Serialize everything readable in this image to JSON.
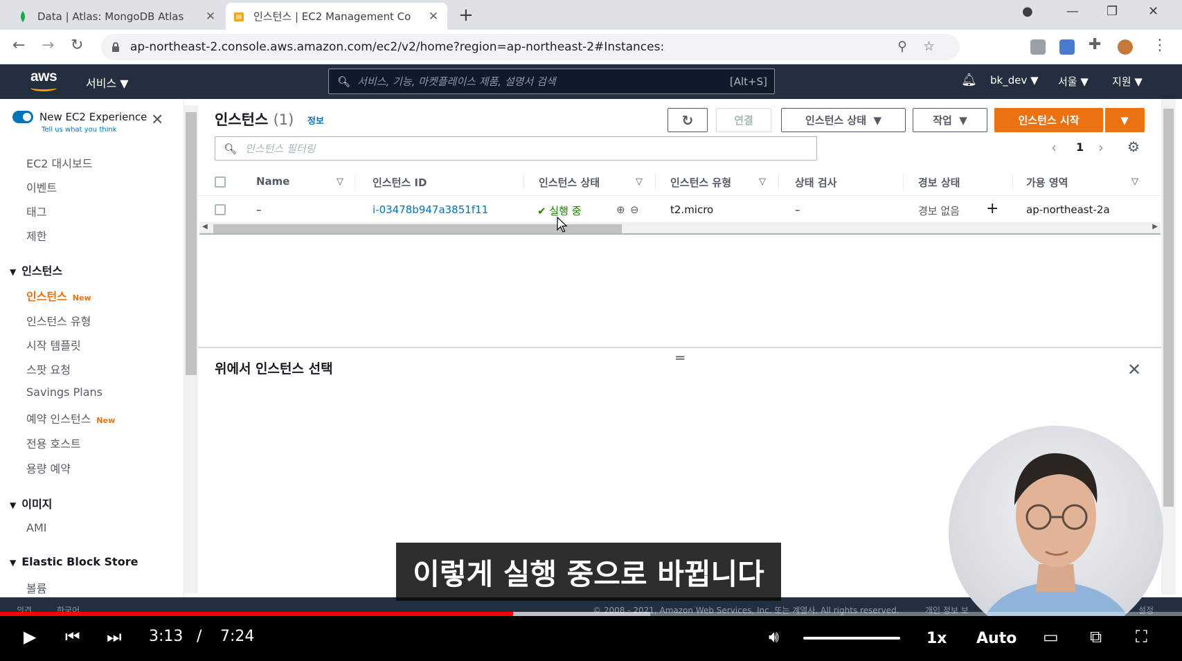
{
  "browser": {
    "tabs": [
      {
        "title": "Data | Atlas: MongoDB Atlas",
        "active": false
      },
      {
        "title": "인스턴스 | EC2 Management Co",
        "active": true
      }
    ],
    "url": "ap-northeast-2.console.aws.amazon.com/ec2/v2/home?region=ap-northeast-2#Instances:"
  },
  "aws_nav": {
    "logo": "aws",
    "services": "서비스",
    "search_placeholder": "서비스, 기능, 마켓플레이스 제품, 설명서 검색",
    "search_shortcut": "[Alt+S]",
    "user": "bk_dev",
    "region": "서울",
    "support": "지원"
  },
  "sidebar": {
    "new_experience": "New EC2 Experience",
    "tell_us": "Tell us what you think",
    "items_top": [
      "EC2 대시보드",
      "이벤트",
      "태그",
      "제한"
    ],
    "section_instances": "인스턴스",
    "instances_items": [
      {
        "label": "인스턴스",
        "badge": "New",
        "active": true
      },
      {
        "label": "인스턴스 유형",
        "badge": "",
        "active": false
      },
      {
        "label": "시작 템플릿",
        "badge": "",
        "active": false
      },
      {
        "label": "스팟 요청",
        "badge": "",
        "active": false
      },
      {
        "label": "Savings Plans",
        "badge": "",
        "active": false
      },
      {
        "label": "예약 인스턴스",
        "badge": "New",
        "active": false
      },
      {
        "label": "전용 호스트",
        "badge": "",
        "active": false
      },
      {
        "label": "용량 예약",
        "badge": "",
        "active": false
      }
    ],
    "section_images": "이미지",
    "images_items": [
      "AMI"
    ],
    "section_ebs": "Elastic Block Store",
    "ebs_items": [
      "볼륨"
    ]
  },
  "main": {
    "title": "인스턴스",
    "count": "(1)",
    "info": "정보",
    "buttons": {
      "connect": "연결",
      "instance_state": "인스턴스 상태",
      "actions": "작업",
      "launch": "인스턴스 시작"
    },
    "filter_placeholder": "인스턴스 필터링",
    "page": "1",
    "columns": [
      "Name",
      "인스턴스 ID",
      "인스턴스 상태",
      "인스턴스 유형",
      "상태 검사",
      "경보 상태",
      "가용 영역"
    ],
    "rows": [
      {
        "name": "–",
        "instance_id": "i-03478b947a3851f11",
        "state": "실행 중",
        "type": "t2.micro",
        "status_check": "–",
        "alarm": "경보 없음",
        "az": "ap-northeast-2a"
      }
    ],
    "split_title": "위에서 인스턴스 선택"
  },
  "aws_footer": {
    "feedback": "의견",
    "language": "한국어",
    "copyright": "© 2008 - 2021, Amazon Web Services, Inc. 또는 계열사. All rights reserved.",
    "privacy": "개인 정보 보",
    "settings": "설정"
  },
  "subtitle": "이렇게 실행 중으로 바뀝니다",
  "player": {
    "current_time": "3:13",
    "separator": "/",
    "duration": "7:24",
    "speed": "1x",
    "quality": "Auto",
    "progress_fraction": 0.434,
    "loaded_fraction": 0.55
  },
  "colors": {
    "aws_nav": "#232f3e",
    "aws_orange": "#ec7211",
    "link_blue": "#0073bb",
    "running_green": "#1d8102",
    "progress_red": "#ff0000"
  }
}
